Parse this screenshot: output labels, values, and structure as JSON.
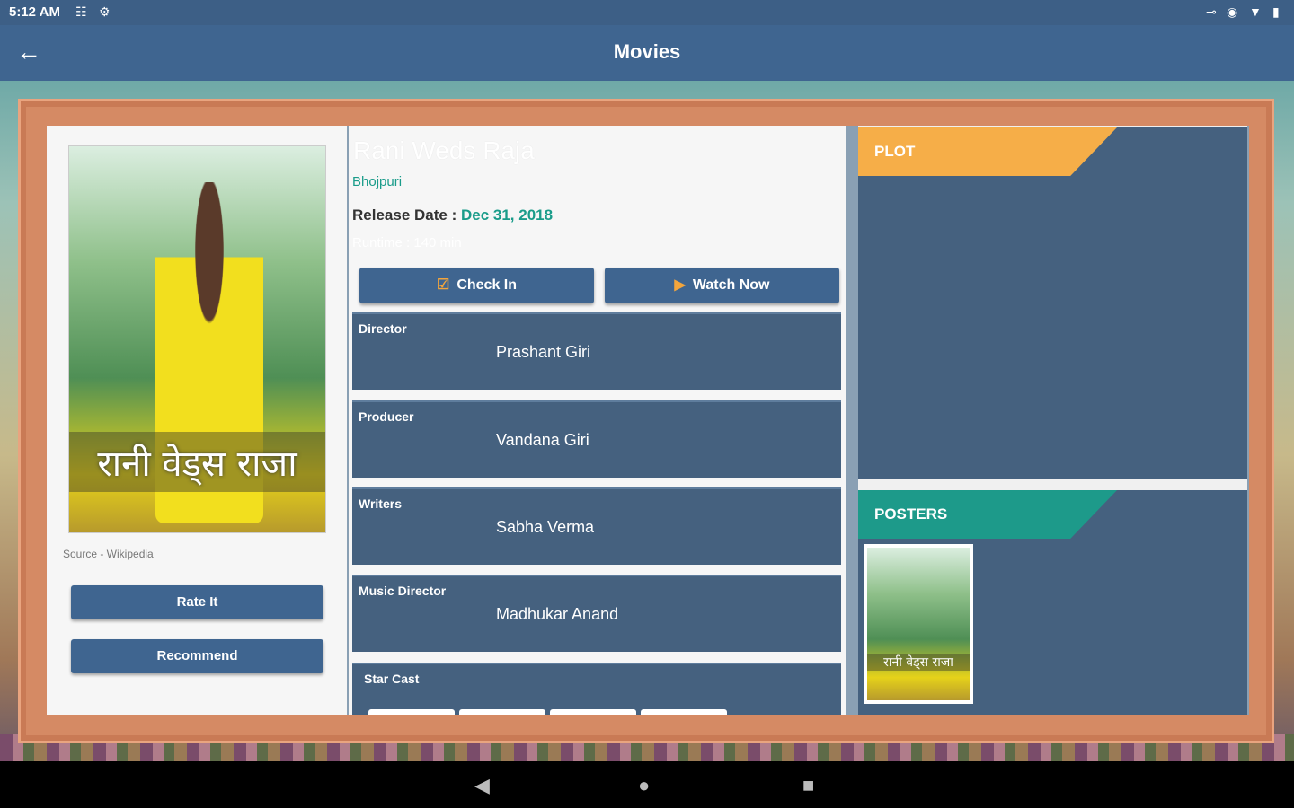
{
  "status_bar": {
    "time": "5:12 AM",
    "left_icons": [
      "android-icon",
      "settings-icon"
    ],
    "right_icons": [
      "key-icon",
      "eye-icon",
      "wifi-icon",
      "battery-icon"
    ]
  },
  "app_bar": {
    "title": "Movies",
    "back_icon": "arrow-left-icon"
  },
  "movie": {
    "poster_text": "रानी वेड्स राजा",
    "source": "Source - Wikipedia",
    "title": "Rani Weds Raja",
    "language": "Bhojpuri",
    "release_label": "Release Date :",
    "release_value": "Dec 31, 2018",
    "runtime": "Runtime : 140 min"
  },
  "left_buttons": {
    "rate": "Rate It",
    "recommend": "Recommend"
  },
  "actions": {
    "check_in": "Check In",
    "watch_now": "Watch Now"
  },
  "crew": [
    {
      "label": "Director",
      "value": "Prashant Giri"
    },
    {
      "label": "Producer",
      "value": "Vandana Giri"
    },
    {
      "label": "Writers",
      "value": "Sabha Verma"
    },
    {
      "label": "Music Director",
      "value": "Madhukar Anand"
    },
    {
      "label": "Star Cast",
      "value": ""
    }
  ],
  "right": {
    "plot_label": "PLOT",
    "posters_label": "POSTERS",
    "poster_thumb_text": "रानी वेड्स राजा"
  },
  "colors": {
    "primary": "#3f6590",
    "card": "#45617f",
    "accent_orange": "#f6ae48",
    "accent_teal": "#1d9a8a",
    "frame": "#d58a64"
  }
}
